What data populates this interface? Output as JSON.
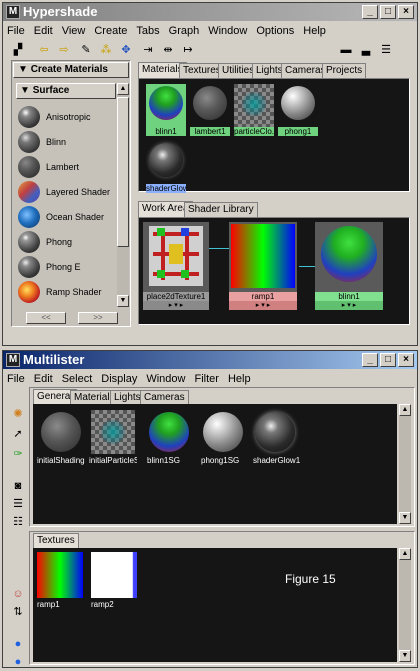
{
  "hypershade": {
    "title": "Hypershade",
    "menu": [
      "File",
      "Edit",
      "View",
      "Create",
      "Tabs",
      "Graph",
      "Window",
      "Options",
      "Help"
    ],
    "create_panel": {
      "header": "Create Materials",
      "sub_header": "Surface",
      "items": [
        "Anisotropic",
        "Blinn",
        "Lambert",
        "Layered Shader",
        "Ocean Shader",
        "Phong",
        "Phong E",
        "Ramp Shader"
      ],
      "scroll_left": "<<",
      "scroll_right": ">>"
    },
    "top_tabs": [
      "Materials",
      "Textures",
      "Utilities",
      "Lights",
      "Cameras",
      "Projects"
    ],
    "materials": [
      "blinn1",
      "lambert1",
      "particleClo...",
      "phong1",
      "shaderGlow1"
    ],
    "work_tabs": [
      "Work Area",
      "Shader Library"
    ],
    "nodes": [
      "place2dTexture1",
      "ramp1",
      "blinn1"
    ]
  },
  "multilister": {
    "title": "Multilister",
    "menu": [
      "File",
      "Edit",
      "Select",
      "Display",
      "Window",
      "Filter",
      "Help"
    ],
    "tabs": [
      "General",
      "Materials",
      "Lights",
      "Cameras"
    ],
    "items": [
      "initialShadingGroup",
      "initialParticleSE",
      "blinn1SG",
      "phong1SG",
      "shaderGlow1"
    ],
    "textures_tab": "Textures",
    "textures": [
      "ramp1",
      "ramp2"
    ],
    "annotation": "Figure 15"
  },
  "icons": [
    "maya-icon",
    "minimize-icon",
    "maximize-icon",
    "close-icon",
    "arrow-left-icon",
    "arrow-right-icon",
    "pencil-icon",
    "graph-icon",
    "select-arrow-icon",
    "pin-icon",
    "sphere-icon"
  ]
}
